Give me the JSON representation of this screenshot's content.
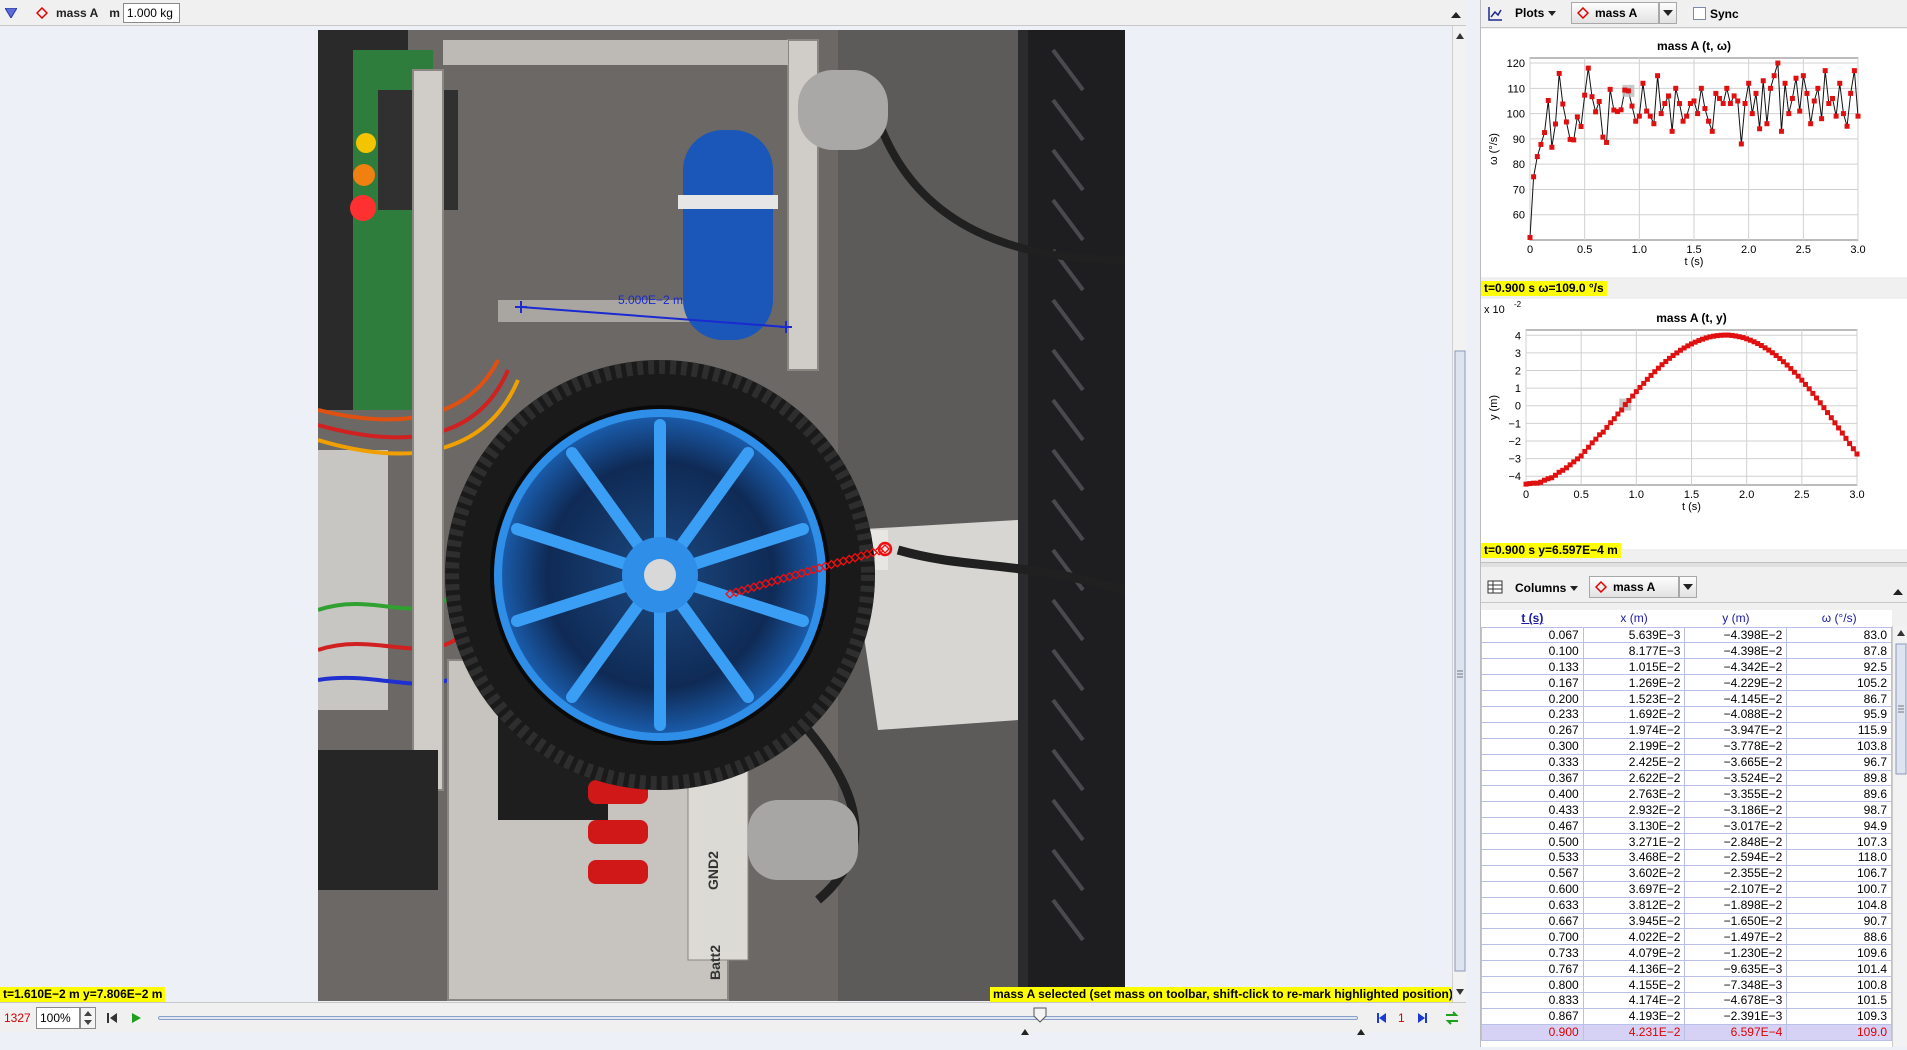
{
  "toolbar": {
    "track_name": "mass A",
    "mass_label": "m",
    "mass_value": "1.000 kg"
  },
  "video": {
    "calibration_label": "5.000E−2 m",
    "cursor_readout": "t=1.610E−2 m  y=7.806E−2 m",
    "status_message": "mass A selected (set mass on toolbar, shift-click to re-mark highlighted position)",
    "labels": {
      "gnd": "GND2",
      "batt": "Batt2"
    }
  },
  "controls": {
    "frame_number": "1327",
    "zoom": "100%",
    "step_value": "1",
    "slider_position": 0.735
  },
  "plots": {
    "menu_label": "Plots",
    "track_selector": "mass A",
    "sync_label": "Sync",
    "plot1": {
      "title": "mass A (t, ω)",
      "xlabel": "t (s)",
      "ylabel": "ω (°/s)",
      "readout": "t=0.900 s  ω=109.0 °/s"
    },
    "plot2": {
      "title": "mass A (t, y)",
      "xlabel": "t (s)",
      "ylabel": "y (m)",
      "multiplier": "x 10",
      "multiplier_exp": "-2",
      "readout": "t=0.900 s  y=6.597E−4 m"
    }
  },
  "table": {
    "menu_label": "Columns",
    "track_selector": "mass A",
    "headers": [
      "t (s)",
      "x (m)",
      "y (m)",
      "ω (°/s)"
    ],
    "rows": [
      [
        "0.067",
        "5.639E−3",
        "−4.398E−2",
        "83.0"
      ],
      [
        "0.100",
        "8.177E−3",
        "−4.398E−2",
        "87.8"
      ],
      [
        "0.133",
        "1.015E−2",
        "−4.342E−2",
        "92.5"
      ],
      [
        "0.167",
        "1.269E−2",
        "−4.229E−2",
        "105.2"
      ],
      [
        "0.200",
        "1.523E−2",
        "−4.145E−2",
        "86.7"
      ],
      [
        "0.233",
        "1.692E−2",
        "−4.088E−2",
        "95.9"
      ],
      [
        "0.267",
        "1.974E−2",
        "−3.947E−2",
        "115.9"
      ],
      [
        "0.300",
        "2.199E−2",
        "−3.778E−2",
        "103.8"
      ],
      [
        "0.333",
        "2.425E−2",
        "−3.665E−2",
        "96.7"
      ],
      [
        "0.367",
        "2.622E−2",
        "−3.524E−2",
        "89.8"
      ],
      [
        "0.400",
        "2.763E−2",
        "−3.355E−2",
        "89.6"
      ],
      [
        "0.433",
        "2.932E−2",
        "−3.186E−2",
        "98.7"
      ],
      [
        "0.467",
        "3.130E−2",
        "−3.017E−2",
        "94.9"
      ],
      [
        "0.500",
        "3.271E−2",
        "−2.848E−2",
        "107.3"
      ],
      [
        "0.533",
        "3.468E−2",
        "−2.594E−2",
        "118.0"
      ],
      [
        "0.567",
        "3.602E−2",
        "−2.355E−2",
        "106.7"
      ],
      [
        "0.600",
        "3.697E−2",
        "−2.107E−2",
        "100.7"
      ],
      [
        "0.633",
        "3.812E−2",
        "−1.898E−2",
        "104.8"
      ],
      [
        "0.667",
        "3.945E−2",
        "−1.650E−2",
        "90.7"
      ],
      [
        "0.700",
        "4.022E−2",
        "−1.497E−2",
        "88.6"
      ],
      [
        "0.733",
        "4.079E−2",
        "−1.230E−2",
        "109.6"
      ],
      [
        "0.767",
        "4.136E−2",
        "−9.635E−3",
        "101.4"
      ],
      [
        "0.800",
        "4.155E−2",
        "−7.348E−3",
        "100.8"
      ],
      [
        "0.833",
        "4.174E−2",
        "−4.678E−3",
        "101.5"
      ],
      [
        "0.867",
        "4.193E−2",
        "−2.391E−3",
        "109.3"
      ],
      [
        "0.900",
        "4.231E−2",
        "6.597E−4",
        "109.0"
      ]
    ]
  },
  "chart_data": [
    {
      "type": "line",
      "title": "mass A (t, ω)",
      "xlabel": "t (s)",
      "ylabel": "ω (°/s)",
      "xlim": [
        0,
        3.0
      ],
      "ylim": [
        50,
        122
      ],
      "xticks": [
        "0",
        "0.5",
        "1.0",
        "1.5",
        "2.0",
        "2.5",
        "3.0"
      ],
      "yticks": [
        "60",
        "70",
        "80",
        "90",
        "100",
        "110",
        "120"
      ],
      "grid": true,
      "highlight_t": 0.9,
      "x": [
        0.0,
        0.033,
        0.067,
        0.1,
        0.133,
        0.167,
        0.2,
        0.233,
        0.267,
        0.3,
        0.333,
        0.367,
        0.4,
        0.433,
        0.467,
        0.5,
        0.533,
        0.567,
        0.6,
        0.633,
        0.667,
        0.7,
        0.733,
        0.767,
        0.8,
        0.833,
        0.867,
        0.9,
        0.933,
        0.967,
        1.0,
        1.033,
        1.067,
        1.1,
        1.133,
        1.167,
        1.2,
        1.233,
        1.267,
        1.3,
        1.333,
        1.367,
        1.4,
        1.433,
        1.467,
        1.5,
        1.533,
        1.567,
        1.6,
        1.633,
        1.667,
        1.7,
        1.733,
        1.767,
        1.8,
        1.833,
        1.867,
        1.9,
        1.933,
        1.967,
        2.0,
        2.033,
        2.067,
        2.1,
        2.133,
        2.167,
        2.2,
        2.233,
        2.267,
        2.3,
        2.333,
        2.367,
        2.4,
        2.433,
        2.467,
        2.5,
        2.533,
        2.567,
        2.6,
        2.633,
        2.667,
        2.7,
        2.733,
        2.767,
        2.8,
        2.833,
        2.867,
        2.9,
        2.933,
        2.967,
        3.0
      ],
      "values": [
        51,
        75,
        83,
        87.8,
        92.5,
        105.2,
        86.7,
        95.9,
        115.9,
        103.8,
        96.7,
        89.8,
        89.6,
        98.7,
        94.9,
        107.3,
        118.0,
        106.7,
        100.7,
        104.8,
        90.7,
        88.6,
        109.6,
        101.4,
        100.8,
        101.5,
        109.3,
        109.0,
        103,
        97,
        99,
        112,
        101,
        99,
        96,
        115,
        100,
        104,
        107,
        93,
        110,
        104,
        97,
        99,
        104,
        105,
        100,
        110,
        102,
        97,
        93,
        108,
        106,
        104,
        110,
        104,
        107,
        105,
        88,
        104,
        112,
        100,
        108,
        94,
        113,
        96,
        110,
        115,
        120,
        93,
        112,
        100,
        106,
        114,
        101,
        115,
        108,
        96,
        105,
        110,
        98,
        117,
        104,
        106,
        99,
        112,
        100,
        95,
        108,
        117,
        99
      ]
    },
    {
      "type": "line",
      "title": "mass A (t, y)",
      "xlabel": "t (s)",
      "ylabel": "y (m)",
      "xlim": [
        0,
        3.0
      ],
      "ylim": [
        -4.5,
        4.3
      ],
      "y_multiplier": "x 10^-2",
      "xticks": [
        "0",
        "0.5",
        "1.0",
        "1.5",
        "2.0",
        "2.5",
        "3.0"
      ],
      "yticks": [
        "4",
        "3",
        "2",
        "1",
        "0",
        "−1",
        "−2",
        "−3",
        "−4"
      ],
      "grid": true,
      "highlight_t": 0.9,
      "x": [
        0.0,
        0.033,
        0.067,
        0.1,
        0.133,
        0.167,
        0.2,
        0.233,
        0.267,
        0.3,
        0.333,
        0.367,
        0.4,
        0.433,
        0.467,
        0.5,
        0.533,
        0.567,
        0.6,
        0.633,
        0.667,
        0.7,
        0.733,
        0.767,
        0.8,
        0.833,
        0.867,
        0.9,
        0.933,
        0.967,
        1.0,
        1.033,
        1.067,
        1.1,
        1.133,
        1.167,
        1.2,
        1.233,
        1.267,
        1.3,
        1.333,
        1.367,
        1.4,
        1.433,
        1.467,
        1.5,
        1.533,
        1.567,
        1.6,
        1.633,
        1.667,
        1.7,
        1.733,
        1.767,
        1.8,
        1.833,
        1.867,
        1.9,
        1.933,
        1.967,
        2.0,
        2.033,
        2.067,
        2.1,
        2.133,
        2.167,
        2.2,
        2.233,
        2.267,
        2.3,
        2.333,
        2.367,
        2.4,
        2.433,
        2.467,
        2.5,
        2.533,
        2.567,
        2.6,
        2.633,
        2.667,
        2.7,
        2.733,
        2.767,
        2.8,
        2.833,
        2.867,
        2.9,
        2.933,
        2.967,
        3.0
      ],
      "values": [
        -4.45,
        -4.42,
        -4.398,
        -4.398,
        -4.342,
        -4.229,
        -4.145,
        -4.088,
        -3.947,
        -3.778,
        -3.665,
        -3.524,
        -3.355,
        -3.186,
        -3.017,
        -2.848,
        -2.594,
        -2.355,
        -2.107,
        -1.898,
        -1.65,
        -1.497,
        -1.23,
        -0.9635,
        -0.7348,
        -0.4678,
        -0.2391,
        0.066,
        0.3,
        0.55,
        0.8,
        1.04,
        1.27,
        1.5,
        1.72,
        1.93,
        2.13,
        2.33,
        2.51,
        2.69,
        2.85,
        3.0,
        3.15,
        3.28,
        3.4,
        3.51,
        3.61,
        3.7,
        3.78,
        3.85,
        3.91,
        3.95,
        3.98,
        4.0,
        4.01,
        4.01,
        3.99,
        3.96,
        3.92,
        3.87,
        3.8,
        3.72,
        3.63,
        3.53,
        3.42,
        3.29,
        3.16,
        3.01,
        2.85,
        2.68,
        2.5,
        2.31,
        2.11,
        1.9,
        1.68,
        1.45,
        1.21,
        0.96,
        0.7,
        0.44,
        0.17,
        -0.11,
        -0.39,
        -0.68,
        -0.97,
        -1.26,
        -1.55,
        -1.85,
        -2.15,
        -2.44,
        -2.74
      ]
    }
  ]
}
